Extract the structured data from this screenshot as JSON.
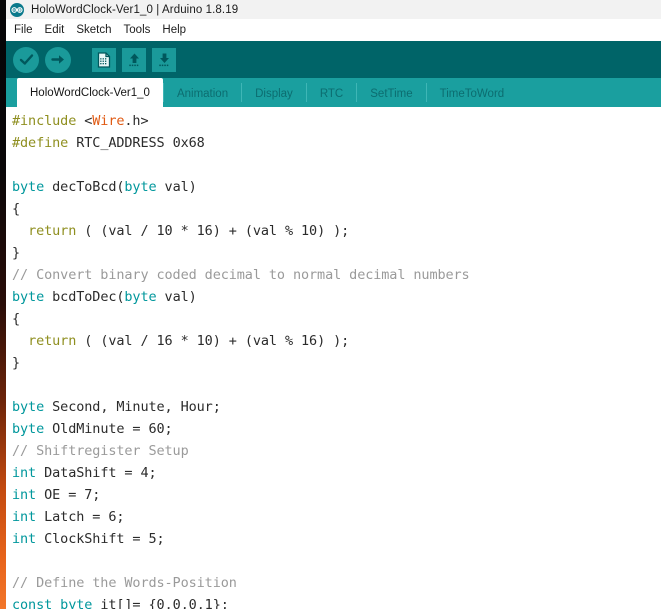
{
  "window": {
    "title": "HoloWordClock-Ver1_0 | Arduino 1.8.19",
    "logo_icon": "arduino-infinity-icon"
  },
  "menubar": {
    "items": [
      {
        "label": "File"
      },
      {
        "label": "Edit"
      },
      {
        "label": "Sketch"
      },
      {
        "label": "Tools"
      },
      {
        "label": "Help"
      }
    ]
  },
  "toolbar": {
    "buttons": [
      {
        "name": "verify-button",
        "icon": "checkmark-icon",
        "tooltip": "Verify"
      },
      {
        "name": "upload-button",
        "icon": "arrow-right-icon",
        "tooltip": "Upload"
      },
      {
        "name": "new-sketch-button",
        "icon": "new-file-icon",
        "tooltip": "New"
      },
      {
        "name": "open-sketch-button",
        "icon": "arrow-up-icon",
        "tooltip": "Open"
      },
      {
        "name": "save-sketch-button",
        "icon": "arrow-down-icon",
        "tooltip": "Save"
      }
    ]
  },
  "tabs": {
    "active_index": 0,
    "items": [
      {
        "label": "HoloWordClock-Ver1_0"
      },
      {
        "label": "Animation"
      },
      {
        "label": "Display"
      },
      {
        "label": "RTC"
      },
      {
        "label": "SetTime"
      },
      {
        "label": "TimeToWord"
      }
    ]
  },
  "editor": {
    "lines": [
      [
        {
          "t": "#include ",
          "c": "pre"
        },
        {
          "t": "<",
          "c": "pl"
        },
        {
          "t": "Wire",
          "c": "lib"
        },
        {
          "t": ".h>",
          "c": "pl"
        }
      ],
      [
        {
          "t": "#define ",
          "c": "pre"
        },
        {
          "t": "RTC_ADDRESS 0x68",
          "c": "pl"
        }
      ],
      [],
      [
        {
          "t": "byte",
          "c": "kw"
        },
        {
          "t": " decToBcd(",
          "c": "pl"
        },
        {
          "t": "byte",
          "c": "kw"
        },
        {
          "t": " val)",
          "c": "pl"
        }
      ],
      [
        {
          "t": "{",
          "c": "pl"
        }
      ],
      [
        {
          "t": "  ",
          "c": "pl"
        },
        {
          "t": "return",
          "c": "fn"
        },
        {
          "t": " ( (val / 10 * 16) + (val % 10) );",
          "c": "pl"
        }
      ],
      [
        {
          "t": "}",
          "c": "pl"
        }
      ],
      [
        {
          "t": "// Convert binary coded decimal to normal decimal numbers",
          "c": "cm"
        }
      ],
      [
        {
          "t": "byte",
          "c": "kw"
        },
        {
          "t": " bcdToDec(",
          "c": "pl"
        },
        {
          "t": "byte",
          "c": "kw"
        },
        {
          "t": " val)",
          "c": "pl"
        }
      ],
      [
        {
          "t": "{",
          "c": "pl"
        }
      ],
      [
        {
          "t": "  ",
          "c": "pl"
        },
        {
          "t": "return",
          "c": "fn"
        },
        {
          "t": " ( (val / 16 * 10) + (val % 16) );",
          "c": "pl"
        }
      ],
      [
        {
          "t": "}",
          "c": "pl"
        }
      ],
      [],
      [
        {
          "t": "byte",
          "c": "kw"
        },
        {
          "t": " Second, Minute, Hour;",
          "c": "pl"
        }
      ],
      [
        {
          "t": "byte",
          "c": "kw"
        },
        {
          "t": " OldMinute = 60;",
          "c": "pl"
        }
      ],
      [
        {
          "t": "// Shiftregister Setup",
          "c": "cm"
        }
      ],
      [
        {
          "t": "int",
          "c": "kw"
        },
        {
          "t": " DataShift = 4;",
          "c": "pl"
        }
      ],
      [
        {
          "t": "int",
          "c": "kw"
        },
        {
          "t": " OE = 7;",
          "c": "pl"
        }
      ],
      [
        {
          "t": "int",
          "c": "kw"
        },
        {
          "t": " Latch = 6;",
          "c": "pl"
        }
      ],
      [
        {
          "t": "int",
          "c": "kw"
        },
        {
          "t": " ClockShift = 5;",
          "c": "pl"
        }
      ],
      [],
      [
        {
          "t": "// Define the Words-Position",
          "c": "cm"
        }
      ],
      [
        {
          "t": "const",
          "c": "kw"
        },
        {
          "t": " ",
          "c": "pl"
        },
        {
          "t": "byte",
          "c": "kw"
        },
        {
          "t": " it[]= {0,0,0,1};",
          "c": "pl"
        }
      ]
    ]
  },
  "colors": {
    "toolbar_bg": "#006468",
    "tabbar_bg": "#1a9f9f",
    "tab_active_bg": "#ffffff",
    "accent_teal": "#00979c",
    "keyword": "#00979c",
    "preprocessor": "#8f8f20",
    "library": "#e05a13",
    "comment": "#9a9a9a",
    "plain_text": "#2b2b2b"
  }
}
